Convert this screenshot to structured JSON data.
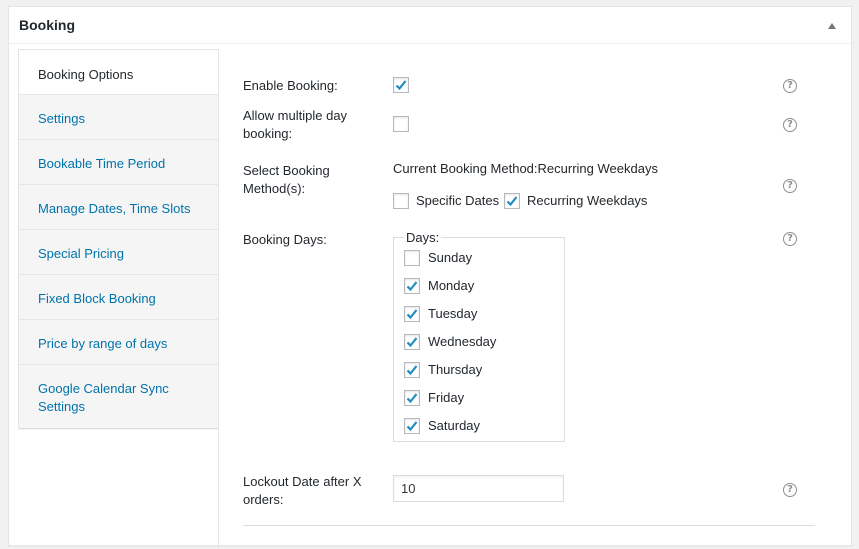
{
  "panel": {
    "title": "Booking",
    "toggle_icon": "arrow-up-icon"
  },
  "tabs": [
    {
      "label": "Booking Options",
      "active": true
    },
    {
      "label": "Settings"
    },
    {
      "label": "Bookable Time Period"
    },
    {
      "label": "Manage Dates, Time Slots"
    },
    {
      "label": "Special Pricing"
    },
    {
      "label": "Fixed Block Booking"
    },
    {
      "label": "Price by range of days"
    },
    {
      "label": "Google Calendar Sync Settings"
    }
  ],
  "fields": {
    "enable_booking": {
      "label": "Enable Booking:",
      "checked": true
    },
    "multiple_day": {
      "label": "Allow multiple day booking:",
      "checked": false
    },
    "booking_method": {
      "label": "Select Booking Method(s):",
      "current": "Current Booking Method:Recurring Weekdays",
      "options": [
        {
          "label": "Specific Dates",
          "checked": false
        },
        {
          "label": "Recurring Weekdays",
          "checked": true
        }
      ]
    },
    "booking_days": {
      "label": "Booking Days:",
      "legend": "Days:",
      "days": [
        {
          "label": "Sunday",
          "checked": false
        },
        {
          "label": "Monday",
          "checked": true
        },
        {
          "label": "Tuesday",
          "checked": true
        },
        {
          "label": "Wednesday",
          "checked": true
        },
        {
          "label": "Thursday",
          "checked": true
        },
        {
          "label": "Friday",
          "checked": true
        },
        {
          "label": "Saturday",
          "checked": true
        }
      ]
    },
    "lockout": {
      "label": "Lockout Date after X orders:",
      "value": "10"
    }
  },
  "help_icon": "?",
  "colors": {
    "link": "#0073aa",
    "check": "#1e8cbe",
    "border": "#e5e5e5"
  }
}
